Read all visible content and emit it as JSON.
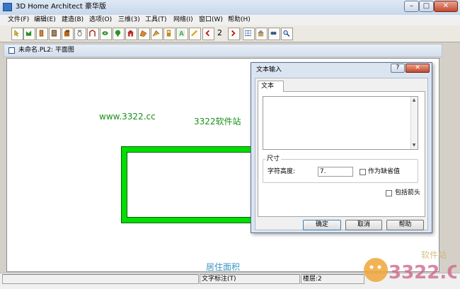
{
  "window": {
    "title": "3D Home Architect 豪华版",
    "controls": {
      "minimize": "–",
      "maximize": "□",
      "close": "✕"
    }
  },
  "menubar": {
    "items": [
      "文件(F)",
      "编辑(E)",
      "建造(B)",
      "选项(O)",
      "三维(3)",
      "工具(T)",
      "网络(I)",
      "窗口(W)",
      "帮助(H)"
    ]
  },
  "toolbar": {
    "page_number": "2",
    "icons": [
      "select-arrow-icon",
      "wall-icon",
      "door-icon",
      "window-icon",
      "cabinet-icon",
      "fixture-icon",
      "furniture-icon",
      "electrical-icon",
      "plant-icon",
      "stairs-icon",
      "roof-icon",
      "materials-icon",
      "layer-icon",
      "text-icon",
      "dimension-icon",
      "prev-page-icon",
      "next-page-icon",
      "floor-plan-view-icon",
      "elevation-view-icon",
      "camera-view-icon",
      "zoom-icon"
    ]
  },
  "document": {
    "title": "未命名.PL2: 平面图",
    "canvas": {
      "watermark_url": "www.3322.cc",
      "site_label": "3322软件站",
      "area_label": "居住面积"
    }
  },
  "dialog": {
    "title": "文本输入",
    "help": "?",
    "close": "✕",
    "tab": "文本",
    "text_value": "",
    "size_group": "尺寸",
    "char_height_label": "字符高度:",
    "char_height_value": "7.",
    "default_checkbox_label": "作为缺省值",
    "default_checked": false,
    "arrow_checkbox_label": "包括箭头",
    "arrow_checked": false,
    "ok": "确定",
    "cancel": "取消",
    "help_button": "帮助"
  },
  "statusbar": {
    "mode": "文字标注(T)",
    "floor": "楼层:2"
  },
  "watermark": {
    "text": "软件站",
    "logo_text": "3322.CC"
  },
  "colors": {
    "building_wall": "#00dd00",
    "site_text": "#1a8f1a",
    "area_text": "#3a95c4"
  }
}
